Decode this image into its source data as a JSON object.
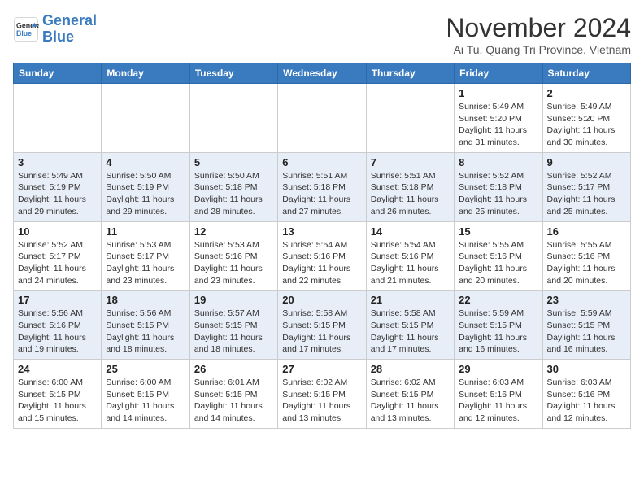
{
  "header": {
    "logo_line1": "General",
    "logo_line2": "Blue",
    "month": "November 2024",
    "location": "Ai Tu, Quang Tri Province, Vietnam"
  },
  "weekdays": [
    "Sunday",
    "Monday",
    "Tuesday",
    "Wednesday",
    "Thursday",
    "Friday",
    "Saturday"
  ],
  "weeks": [
    [
      {
        "day": "",
        "info": ""
      },
      {
        "day": "",
        "info": ""
      },
      {
        "day": "",
        "info": ""
      },
      {
        "day": "",
        "info": ""
      },
      {
        "day": "",
        "info": ""
      },
      {
        "day": "1",
        "info": "Sunrise: 5:49 AM\nSunset: 5:20 PM\nDaylight: 11 hours\nand 31 minutes."
      },
      {
        "day": "2",
        "info": "Sunrise: 5:49 AM\nSunset: 5:20 PM\nDaylight: 11 hours\nand 30 minutes."
      }
    ],
    [
      {
        "day": "3",
        "info": "Sunrise: 5:49 AM\nSunset: 5:19 PM\nDaylight: 11 hours\nand 29 minutes."
      },
      {
        "day": "4",
        "info": "Sunrise: 5:50 AM\nSunset: 5:19 PM\nDaylight: 11 hours\nand 29 minutes."
      },
      {
        "day": "5",
        "info": "Sunrise: 5:50 AM\nSunset: 5:18 PM\nDaylight: 11 hours\nand 28 minutes."
      },
      {
        "day": "6",
        "info": "Sunrise: 5:51 AM\nSunset: 5:18 PM\nDaylight: 11 hours\nand 27 minutes."
      },
      {
        "day": "7",
        "info": "Sunrise: 5:51 AM\nSunset: 5:18 PM\nDaylight: 11 hours\nand 26 minutes."
      },
      {
        "day": "8",
        "info": "Sunrise: 5:52 AM\nSunset: 5:18 PM\nDaylight: 11 hours\nand 25 minutes."
      },
      {
        "day": "9",
        "info": "Sunrise: 5:52 AM\nSunset: 5:17 PM\nDaylight: 11 hours\nand 25 minutes."
      }
    ],
    [
      {
        "day": "10",
        "info": "Sunrise: 5:52 AM\nSunset: 5:17 PM\nDaylight: 11 hours\nand 24 minutes."
      },
      {
        "day": "11",
        "info": "Sunrise: 5:53 AM\nSunset: 5:17 PM\nDaylight: 11 hours\nand 23 minutes."
      },
      {
        "day": "12",
        "info": "Sunrise: 5:53 AM\nSunset: 5:16 PM\nDaylight: 11 hours\nand 23 minutes."
      },
      {
        "day": "13",
        "info": "Sunrise: 5:54 AM\nSunset: 5:16 PM\nDaylight: 11 hours\nand 22 minutes."
      },
      {
        "day": "14",
        "info": "Sunrise: 5:54 AM\nSunset: 5:16 PM\nDaylight: 11 hours\nand 21 minutes."
      },
      {
        "day": "15",
        "info": "Sunrise: 5:55 AM\nSunset: 5:16 PM\nDaylight: 11 hours\nand 20 minutes."
      },
      {
        "day": "16",
        "info": "Sunrise: 5:55 AM\nSunset: 5:16 PM\nDaylight: 11 hours\nand 20 minutes."
      }
    ],
    [
      {
        "day": "17",
        "info": "Sunrise: 5:56 AM\nSunset: 5:16 PM\nDaylight: 11 hours\nand 19 minutes."
      },
      {
        "day": "18",
        "info": "Sunrise: 5:56 AM\nSunset: 5:15 PM\nDaylight: 11 hours\nand 18 minutes."
      },
      {
        "day": "19",
        "info": "Sunrise: 5:57 AM\nSunset: 5:15 PM\nDaylight: 11 hours\nand 18 minutes."
      },
      {
        "day": "20",
        "info": "Sunrise: 5:58 AM\nSunset: 5:15 PM\nDaylight: 11 hours\nand 17 minutes."
      },
      {
        "day": "21",
        "info": "Sunrise: 5:58 AM\nSunset: 5:15 PM\nDaylight: 11 hours\nand 17 minutes."
      },
      {
        "day": "22",
        "info": "Sunrise: 5:59 AM\nSunset: 5:15 PM\nDaylight: 11 hours\nand 16 minutes."
      },
      {
        "day": "23",
        "info": "Sunrise: 5:59 AM\nSunset: 5:15 PM\nDaylight: 11 hours\nand 16 minutes."
      }
    ],
    [
      {
        "day": "24",
        "info": "Sunrise: 6:00 AM\nSunset: 5:15 PM\nDaylight: 11 hours\nand 15 minutes."
      },
      {
        "day": "25",
        "info": "Sunrise: 6:00 AM\nSunset: 5:15 PM\nDaylight: 11 hours\nand 14 minutes."
      },
      {
        "day": "26",
        "info": "Sunrise: 6:01 AM\nSunset: 5:15 PM\nDaylight: 11 hours\nand 14 minutes."
      },
      {
        "day": "27",
        "info": "Sunrise: 6:02 AM\nSunset: 5:15 PM\nDaylight: 11 hours\nand 13 minutes."
      },
      {
        "day": "28",
        "info": "Sunrise: 6:02 AM\nSunset: 5:15 PM\nDaylight: 11 hours\nand 13 minutes."
      },
      {
        "day": "29",
        "info": "Sunrise: 6:03 AM\nSunset: 5:16 PM\nDaylight: 11 hours\nand 12 minutes."
      },
      {
        "day": "30",
        "info": "Sunrise: 6:03 AM\nSunset: 5:16 PM\nDaylight: 11 hours\nand 12 minutes."
      }
    ]
  ]
}
